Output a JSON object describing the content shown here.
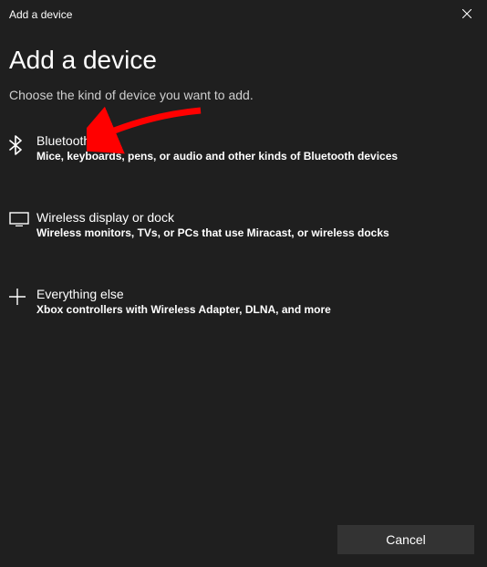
{
  "titlebar": {
    "title": "Add a device"
  },
  "heading": "Add a device",
  "subheading": "Choose the kind of device you want to add.",
  "options": [
    {
      "title": "Bluetooth",
      "desc": "Mice, keyboards, pens, or audio and other kinds of Bluetooth devices"
    },
    {
      "title": "Wireless display or dock",
      "desc": "Wireless monitors, TVs, or PCs that use Miracast, or wireless docks"
    },
    {
      "title": "Everything else",
      "desc": "Xbox controllers with Wireless Adapter, DLNA, and more"
    }
  ],
  "footer": {
    "cancel": "Cancel"
  },
  "annotation": {
    "arrow_color": "#ff0000"
  }
}
